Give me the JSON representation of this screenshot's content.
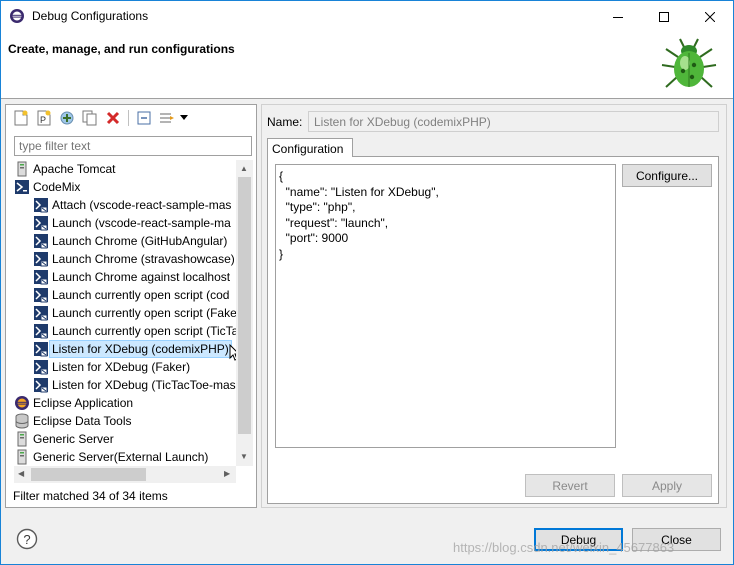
{
  "window": {
    "title": "Debug Configurations",
    "min_glyph": "—",
    "max_glyph": "☐",
    "close_glyph": "✕"
  },
  "banner": {
    "title": "Create, manage, and run configurations"
  },
  "left": {
    "filter_placeholder": "type filter text",
    "filter_status": "Filter matched 34 of 34 items",
    "tree": [
      {
        "label": "Apache Tomcat",
        "icon": "server-icon",
        "level": 0
      },
      {
        "label": "CodeMix",
        "icon": "codemix-icon",
        "level": 0
      },
      {
        "label": "Attach (vscode-react-sample-mas",
        "icon": "codemix-launch-icon",
        "level": 1
      },
      {
        "label": "Launch (vscode-react-sample-ma",
        "icon": "codemix-launch-icon",
        "level": 1
      },
      {
        "label": "Launch Chrome (GitHubAngular)",
        "icon": "codemix-launch-icon",
        "level": 1
      },
      {
        "label": "Launch Chrome (stravashowcase)",
        "icon": "codemix-launch-icon",
        "level": 1
      },
      {
        "label": "Launch Chrome against localhost",
        "icon": "codemix-launch-icon",
        "level": 1
      },
      {
        "label": "Launch currently open script (cod",
        "icon": "codemix-launch-icon",
        "level": 1
      },
      {
        "label": "Launch currently open script (Fake",
        "icon": "codemix-launch-icon",
        "level": 1
      },
      {
        "label": "Launch currently open script (TicTa",
        "icon": "codemix-launch-icon",
        "level": 1
      },
      {
        "label": "Listen for XDebug (codemixPHP)",
        "icon": "codemix-launch-icon",
        "level": 1,
        "selected": true
      },
      {
        "label": "Listen for XDebug (Faker)",
        "icon": "codemix-launch-icon",
        "level": 1
      },
      {
        "label": "Listen for XDebug (TicTacToe-mas",
        "icon": "codemix-launch-icon",
        "level": 1
      },
      {
        "label": "Eclipse Application",
        "icon": "eclipse-icon",
        "level": 0
      },
      {
        "label": "Eclipse Data Tools",
        "icon": "database-icon",
        "level": 0
      },
      {
        "label": "Generic Server",
        "icon": "server-icon",
        "level": 0
      },
      {
        "label": "Generic Server(External Launch)",
        "icon": "server-icon",
        "level": 0
      }
    ]
  },
  "right": {
    "name_label": "Name:",
    "name_value": "Listen for XDebug (codemixPHP)",
    "tab_label": "Configuration",
    "json_text": "{\n  \"name\": \"Listen for XDebug\",\n  \"type\": \"php\",\n  \"request\": \"launch\",\n  \"port\": 9000\n}",
    "configure_label": "Configure...",
    "revert_label": "Revert",
    "apply_label": "Apply"
  },
  "footer": {
    "debug_label": "Debug",
    "close_label": "Close",
    "watermark": "https://blog.csdn.net/weixin_45677863"
  }
}
